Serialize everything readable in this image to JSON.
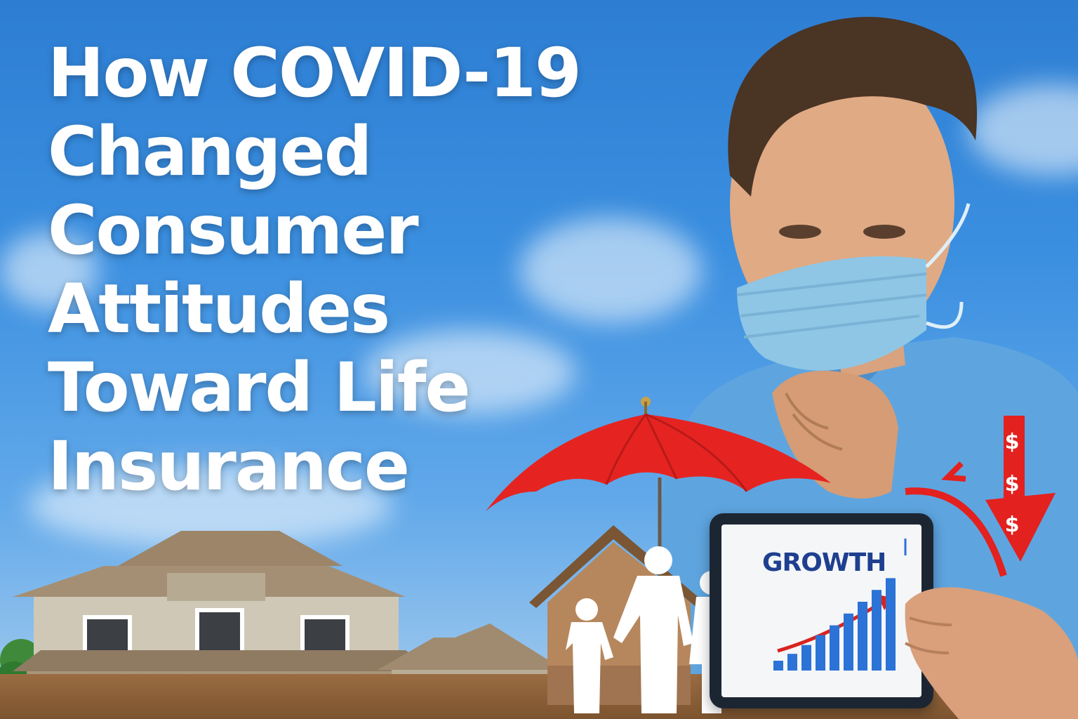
{
  "headline": {
    "lines": [
      "How COVID-19",
      "Changed",
      "Consumer",
      "Attitudes",
      "Toward Life",
      "Insurance"
    ]
  },
  "tablet": {
    "label": "GROWTH",
    "bars": [
      0.1,
      0.17,
      0.26,
      0.36,
      0.46,
      0.58,
      0.7,
      0.82,
      0.94
    ]
  },
  "arrow": {
    "symbols": [
      "$",
      "$",
      "$"
    ]
  },
  "colors": {
    "sky_top": "#2d7ed3",
    "sky_bottom": "#a7cdee",
    "umbrella": "#e52421",
    "arrow": "#e3211f",
    "mask": "#8fc6e6",
    "shirt": "#5ea5e0",
    "growth_text": "#1f3f8f",
    "bar": "#2b73d6"
  }
}
